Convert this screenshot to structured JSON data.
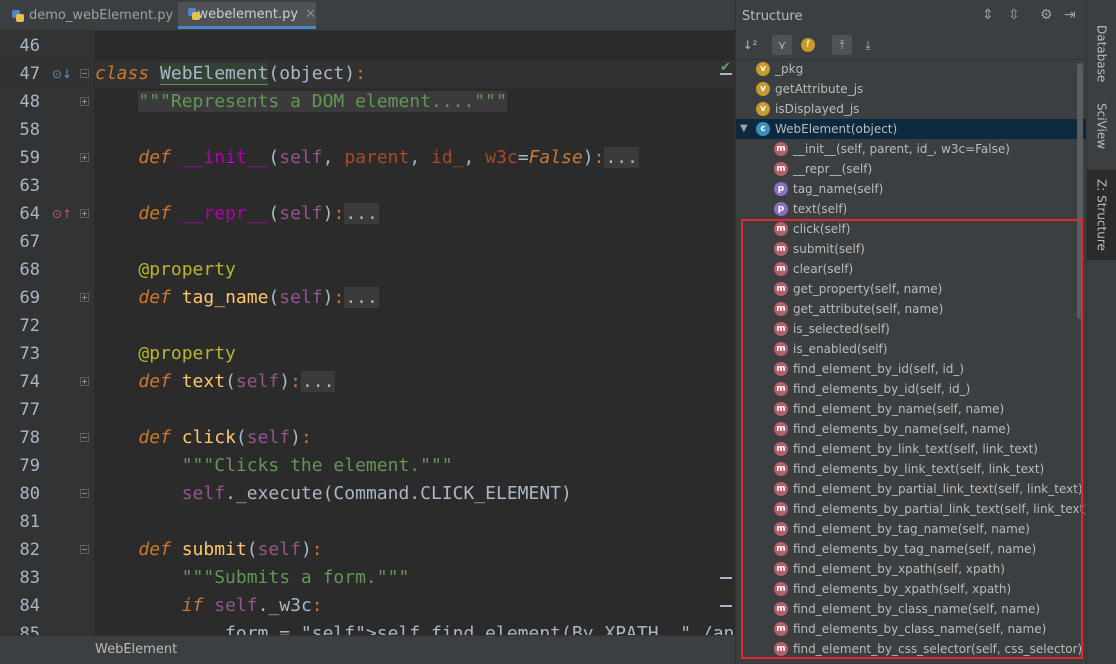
{
  "tabs": [
    {
      "label": "demo_webElement.py",
      "active": false
    },
    {
      "label": "webelement.py",
      "active": true
    }
  ],
  "editor": {
    "lines": [
      {
        "num": "46",
        "text": ""
      },
      {
        "num": "47",
        "text": "class WebElement(object):"
      },
      {
        "num": "48",
        "text": "    \"\"\"Represents a DOM element....\"\"\""
      },
      {
        "num": "58",
        "text": ""
      },
      {
        "num": "59",
        "text": "    def __init__(self, parent, id_, w3c=False):..."
      },
      {
        "num": "63",
        "text": ""
      },
      {
        "num": "64",
        "text": "    def __repr__(self):..."
      },
      {
        "num": "67",
        "text": ""
      },
      {
        "num": "68",
        "text": "    @property"
      },
      {
        "num": "69",
        "text": "    def tag_name(self):..."
      },
      {
        "num": "72",
        "text": ""
      },
      {
        "num": "73",
        "text": "    @property"
      },
      {
        "num": "74",
        "text": "    def text(self):..."
      },
      {
        "num": "77",
        "text": ""
      },
      {
        "num": "78",
        "text": "    def click(self):"
      },
      {
        "num": "79",
        "text": "        \"\"\"Clicks the element.\"\"\""
      },
      {
        "num": "80",
        "text": "        self._execute(Command.CLICK_ELEMENT)"
      },
      {
        "num": "81",
        "text": ""
      },
      {
        "num": "82",
        "text": "    def submit(self):"
      },
      {
        "num": "83",
        "text": "        \"\"\"Submits a form.\"\"\""
      },
      {
        "num": "84",
        "text": "        if self._w3c:"
      },
      {
        "num": "85",
        "text": "            form = self.find_element(By.XPATH, \"./ancestor-or-self::form\")"
      }
    ],
    "status_breadcrumb": "WebElement"
  },
  "structure": {
    "title": "Structure",
    "tree": [
      {
        "icon": "v",
        "label": "_pkg",
        "depth": 0
      },
      {
        "icon": "v",
        "label": "getAttribute_js",
        "depth": 0
      },
      {
        "icon": "v",
        "label": "isDisplayed_js",
        "depth": 0
      },
      {
        "icon": "c",
        "label": "WebElement(object)",
        "depth": 0,
        "selected": true,
        "expanded": true
      },
      {
        "icon": "m",
        "label": "__init__(self, parent, id_, w3c=False)",
        "depth": 1
      },
      {
        "icon": "m",
        "label": "__repr__(self)",
        "depth": 1
      },
      {
        "icon": "p",
        "label": "tag_name(self)",
        "depth": 1
      },
      {
        "icon": "p",
        "label": "text(self)",
        "depth": 1
      },
      {
        "icon": "m",
        "label": "click(self)",
        "depth": 1
      },
      {
        "icon": "m",
        "label": "submit(self)",
        "depth": 1
      },
      {
        "icon": "m",
        "label": "clear(self)",
        "depth": 1
      },
      {
        "icon": "m",
        "label": "get_property(self, name)",
        "depth": 1
      },
      {
        "icon": "m",
        "label": "get_attribute(self, name)",
        "depth": 1
      },
      {
        "icon": "m",
        "label": "is_selected(self)",
        "depth": 1
      },
      {
        "icon": "m",
        "label": "is_enabled(self)",
        "depth": 1
      },
      {
        "icon": "m",
        "label": "find_element_by_id(self, id_)",
        "depth": 1
      },
      {
        "icon": "m",
        "label": "find_elements_by_id(self, id_)",
        "depth": 1
      },
      {
        "icon": "m",
        "label": "find_element_by_name(self, name)",
        "depth": 1
      },
      {
        "icon": "m",
        "label": "find_elements_by_name(self, name)",
        "depth": 1
      },
      {
        "icon": "m",
        "label": "find_element_by_link_text(self, link_text)",
        "depth": 1
      },
      {
        "icon": "m",
        "label": "find_elements_by_link_text(self, link_text)",
        "depth": 1
      },
      {
        "icon": "m",
        "label": "find_element_by_partial_link_text(self, link_text)",
        "depth": 1
      },
      {
        "icon": "m",
        "label": "find_elements_by_partial_link_text(self, link_text)",
        "depth": 1
      },
      {
        "icon": "m",
        "label": "find_element_by_tag_name(self, name)",
        "depth": 1
      },
      {
        "icon": "m",
        "label": "find_elements_by_tag_name(self, name)",
        "depth": 1
      },
      {
        "icon": "m",
        "label": "find_element_by_xpath(self, xpath)",
        "depth": 1
      },
      {
        "icon": "m",
        "label": "find_elements_by_xpath(self, xpath)",
        "depth": 1
      },
      {
        "icon": "m",
        "label": "find_element_by_class_name(self, name)",
        "depth": 1
      },
      {
        "icon": "m",
        "label": "find_elements_by_class_name(self, name)",
        "depth": 1
      },
      {
        "icon": "m",
        "label": "find_element_by_css_selector(self, css_selector)",
        "depth": 1
      }
    ]
  },
  "side_tabs": [
    "Database",
    "SciView",
    "Z: Structure"
  ],
  "icon_letters": {
    "v": "v",
    "m": "m",
    "p": "p",
    "c": "c"
  }
}
